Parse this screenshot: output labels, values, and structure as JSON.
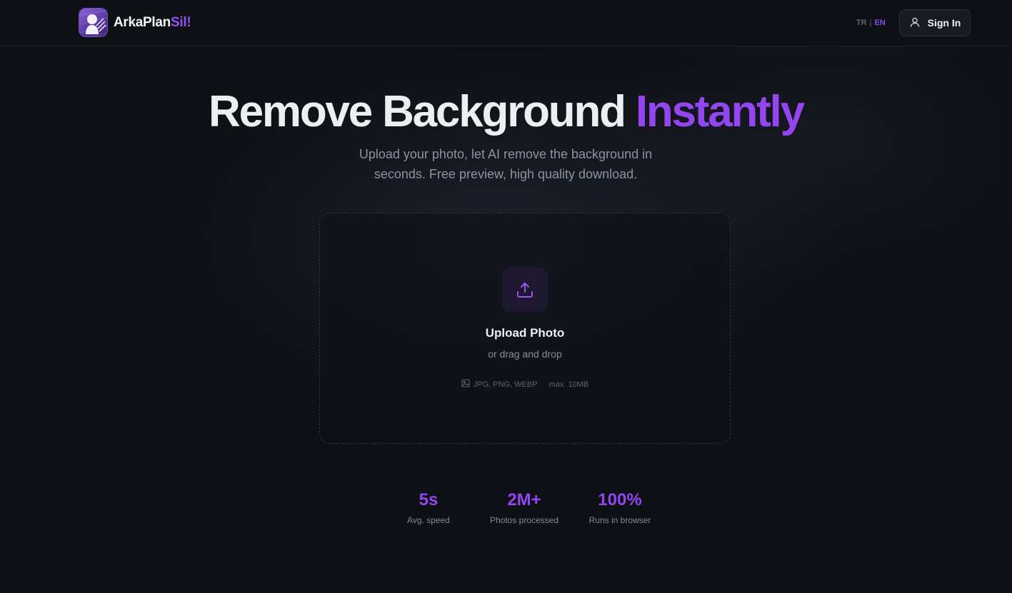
{
  "brand": {
    "name_main": "ArkaPlan",
    "name_accent": "Sil!",
    "accent_color": "#9450f0"
  },
  "header": {
    "lang_tr": "TR",
    "lang_sep": "|",
    "lang_en": "EN",
    "signin_label": "Sign In",
    "signin_icon": "user-icon"
  },
  "hero": {
    "title_main": "Remove Background",
    "title_accent": "Instantly",
    "subtitle_line1": "Upload your photo, let AI remove the background in",
    "subtitle_line2": "seconds. Free preview, high quality download."
  },
  "upload": {
    "icon": "upload-icon",
    "title": "Upload Photo",
    "subtitle": "or drag and drop",
    "formats": "JPG, PNG, WEBP",
    "formats_icon": "image-icon",
    "max_size": "max. 10MB"
  },
  "stats": [
    {
      "value": "5s",
      "label": "Avg. speed"
    },
    {
      "value": "2M+",
      "label": "Photos processed"
    },
    {
      "value": "100%",
      "label": "Runs in browser"
    }
  ],
  "colors": {
    "background": "#0d1015",
    "accent": "#9345f0",
    "text": "#eceef1",
    "muted": "#8c93a0"
  }
}
